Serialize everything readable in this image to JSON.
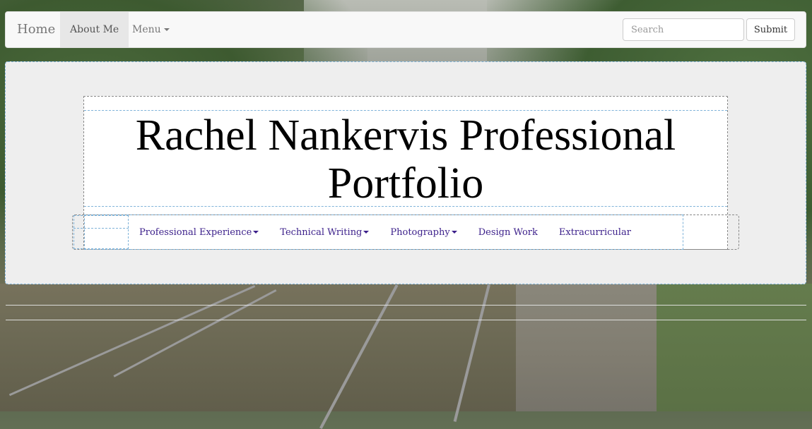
{
  "navbar": {
    "brand": "Home",
    "about_label": "About Me",
    "menu_label": "Menu",
    "search_placeholder": "Search",
    "submit_label": "Submit"
  },
  "header": {
    "title": "Rachel Nankervis Professional Portfolio"
  },
  "subnav": {
    "items": [
      {
        "label": "Professional Experience",
        "dropdown": true
      },
      {
        "label": "Technical Writing",
        "dropdown": true
      },
      {
        "label": "Photography",
        "dropdown": true
      },
      {
        "label": "Design Work",
        "dropdown": false
      },
      {
        "label": "Extracurricular",
        "dropdown": false
      }
    ]
  },
  "colors": {
    "link": "#3b1f8a",
    "jumbotron_bg": "#eeeeee",
    "navbar_bg": "#f8f8f8",
    "active_tab_bg": "#e7e7e7"
  }
}
